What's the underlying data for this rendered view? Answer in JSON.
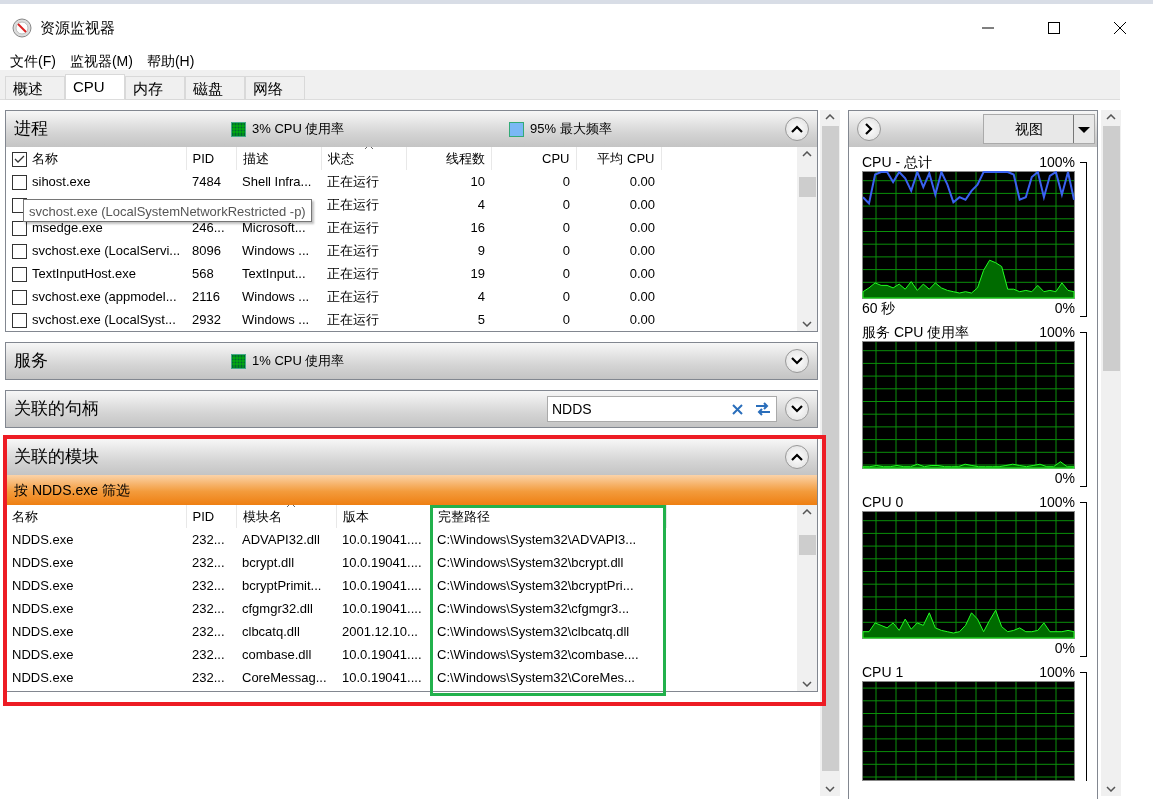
{
  "window": {
    "title": "资源监视器"
  },
  "menu": [
    {
      "label": "文件(F)"
    },
    {
      "label": "监视器(M)"
    },
    {
      "label": "帮助(H)"
    }
  ],
  "tabs": [
    {
      "label": "概述",
      "selected": false
    },
    {
      "label": "CPU",
      "selected": true
    },
    {
      "label": "内存",
      "selected": false
    },
    {
      "label": "磁盘",
      "selected": false
    },
    {
      "label": "网络",
      "selected": false
    }
  ],
  "processes": {
    "title": "进程",
    "expanded": true,
    "indicators": [
      {
        "kind": "usage",
        "text": "3% CPU 使用率"
      },
      {
        "kind": "frequency",
        "text": "95% 最大频率"
      }
    ],
    "select_all": true,
    "columns": [
      {
        "label": "名称",
        "sorted": false
      },
      {
        "label": "PID",
        "sorted": false
      },
      {
        "label": "描述",
        "sorted": false
      },
      {
        "label": "状态",
        "sorted": true
      },
      {
        "label": "线程数",
        "sorted": false
      },
      {
        "label": "CPU",
        "sorted": false
      },
      {
        "label": "平均 CPU",
        "sorted": false
      }
    ],
    "rows": [
      {
        "checked": false,
        "cells": [
          "sihost.exe",
          "7484",
          "Shell Infra...",
          "正在运行",
          "10",
          "0",
          "0.00"
        ]
      },
      {
        "checked": false,
        "cells": [
          null,
          null,
          null,
          "正在运行",
          "4",
          "0",
          "0.00"
        ]
      },
      {
        "checked": false,
        "cells": [
          "msedge.exe",
          "246...",
          "Microsoft...",
          "正在运行",
          "16",
          "0",
          "0.00"
        ]
      },
      {
        "checked": false,
        "cells": [
          "svchost.exe (LocalServi...",
          "8096",
          "Windows ...",
          "正在运行",
          "9",
          "0",
          "0.00"
        ]
      },
      {
        "checked": false,
        "cells": [
          "TextInputHost.exe",
          "568",
          "TextInput...",
          "正在运行",
          "19",
          "0",
          "0.00"
        ]
      },
      {
        "checked": false,
        "cells": [
          "svchost.exe (appmodel...",
          "2116",
          "Windows ...",
          "正在运行",
          "4",
          "0",
          "0.00"
        ]
      },
      {
        "checked": false,
        "cells": [
          "svchost.exe (LocalSyst...",
          "2932",
          "Windows ...",
          "正在运行",
          "5",
          "0",
          "0.00"
        ]
      }
    ],
    "tooltip": "svchost.exe (LocalSystemNetworkRestricted -p)"
  },
  "services": {
    "title": "服务",
    "expanded": false,
    "indicators": [
      {
        "kind": "usage",
        "text": "1% CPU 使用率"
      }
    ]
  },
  "handles": {
    "title": "关联的句柄",
    "expanded": false,
    "search": {
      "value": "NDDS"
    }
  },
  "modules": {
    "title": "关联的模块",
    "expanded": true,
    "filter": "按 NDDS.exe 筛选",
    "columns": [
      {
        "label": "名称",
        "sorted": false
      },
      {
        "label": "PID",
        "sorted": false
      },
      {
        "label": "模块名",
        "sorted": true
      },
      {
        "label": "版本",
        "sorted": false
      },
      {
        "label": "完整路径",
        "sorted": false
      }
    ],
    "rows": [
      {
        "cells": [
          "NDDS.exe",
          "232...",
          "ADVAPI32.dll",
          "10.0.19041....",
          "C:\\Windows\\System32\\ADVAPI3..."
        ]
      },
      {
        "cells": [
          "NDDS.exe",
          "232...",
          "bcrypt.dll",
          "10.0.19041....",
          "C:\\Windows\\System32\\bcrypt.dll"
        ]
      },
      {
        "cells": [
          "NDDS.exe",
          "232...",
          "bcryptPrimit...",
          "10.0.19041....",
          "C:\\Windows\\System32\\bcryptPri..."
        ]
      },
      {
        "cells": [
          "NDDS.exe",
          "232...",
          "cfgmgr32.dll",
          "10.0.19041....",
          "C:\\Windows\\System32\\cfgmgr3..."
        ]
      },
      {
        "cells": [
          "NDDS.exe",
          "232...",
          "clbcatq.dll",
          "2001.12.10...",
          "C:\\Windows\\System32\\clbcatq.dll"
        ]
      },
      {
        "cells": [
          "NDDS.exe",
          "232...",
          "combase.dll",
          "10.0.19041....",
          "C:\\Windows\\System32\\combase...."
        ]
      },
      {
        "cells": [
          "NDDS.exe",
          "232...",
          "CoreMessag...",
          "10.0.19041....",
          "C:\\Windows\\System32\\CoreMes..."
        ]
      }
    ]
  },
  "highlights": [
    {
      "color": "#ed1c24"
    },
    {
      "color": "#22b14c"
    }
  ],
  "graph_panel": {
    "view_button": "视图",
    "graphs": [
      {
        "title": "CPU - 总计",
        "max": "100%",
        "time": "60 秒",
        "min": "0%"
      },
      {
        "title": "服务 CPU 使用率",
        "max": "100%",
        "min": "0%"
      },
      {
        "title": "CPU 0",
        "max": "100%",
        "min": "0%"
      },
      {
        "title": "CPU 1",
        "max": "100%"
      }
    ]
  }
}
